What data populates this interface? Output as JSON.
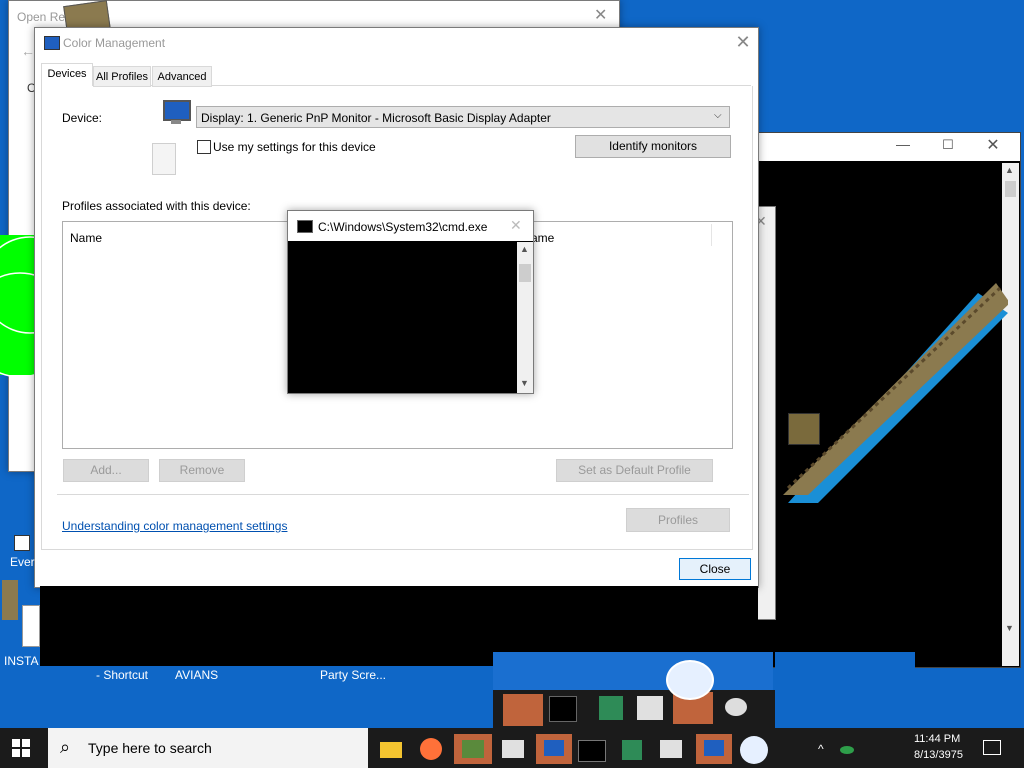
{
  "colors": {
    "desktop": "#0f67c7",
    "taskbar": "#1b1b1b",
    "accent": "#0078d7"
  },
  "background_windows": {
    "open_recent_title": "Open Rec",
    "ok_label": "OK"
  },
  "color_management": {
    "title": "Color Management",
    "tabs": [
      "Devices",
      "All Profiles",
      "Advanced"
    ],
    "device_label": "Device:",
    "device_value": "Display: 1. Generic PnP Monitor - Microsoft Basic Display Adapter",
    "use_settings_label": "Use my settings for this device",
    "identify_button": "Identify monitors",
    "profiles_label": "Profiles associated with this device:",
    "name_header": "Name",
    "name_header_right": "ame",
    "add_button": "Add...",
    "remove_button": "Remove",
    "set_default_button": "Set as Default Profile",
    "profiles_button": "Profiles",
    "link_text": "Understanding color management settings",
    "close_button": "Close"
  },
  "cmd": {
    "title": "C:\\Windows\\System32\\cmd.exe"
  },
  "desktop_labels": [
    "Ever",
    "INSTA",
    "- Shortcut",
    "AVIANS",
    "Party Scre..."
  ],
  "taskbar": {
    "search_placeholder": "Type here to search",
    "time": "11:44 PM",
    "date": "8/13/3975"
  },
  "tray_fragments": [
    "8/",
    "1:"
  ]
}
